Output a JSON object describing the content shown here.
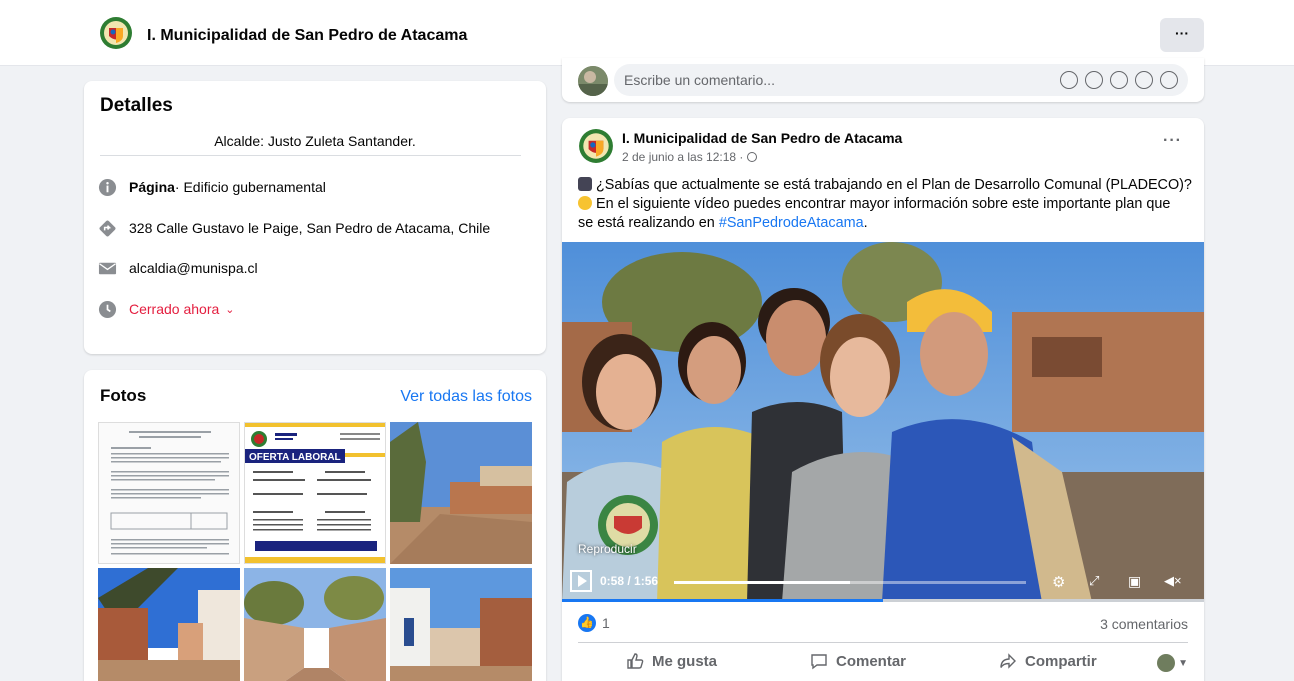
{
  "header": {
    "page_title": "I. Municipalidad de San Pedro de Atacama",
    "more_label": "···"
  },
  "details": {
    "heading": "Detalles",
    "bio": "Alcalde: Justo Zuleta Santander.",
    "category_bold": "Página",
    "category_rest": " · Edificio gubernamental",
    "address": "328 Calle Gustavo le Paige, San Pedro de Atacama, Chile",
    "email": "alcaldia@munispa.cl",
    "hours_status": "Cerrado ahora",
    "hours_caret": "⌄"
  },
  "photos": {
    "heading": "Fotos",
    "see_all": "Ver todas las fotos",
    "poster_title": "OFERTA LABORAL"
  },
  "comment_composer": {
    "placeholder": "Escribe un comentario..."
  },
  "post": {
    "page_name": "I. Municipalidad de San Pedro de Atacama",
    "meta": "2 de junio a las 12:18 · ",
    "more": "···",
    "line1": "¿Sabías que actualmente se está trabajando en el Plan de Desarrollo Comunal (PLADECO)?",
    "line2": "En el siguiente vídeo puedes encontrar mayor información sobre este importante plan que",
    "line3_pre": "se está realizando en ",
    "hashtag": "#SanPedrodeAtacama",
    "line3_post": ".",
    "video": {
      "play_label": "Reproducir",
      "time": "0:58 / 1:56",
      "progress": 0.5
    },
    "likes_count": "1",
    "comments_count": "3 comentarios",
    "actions": {
      "like": "Me gusta",
      "comment": "Comentar",
      "share": "Compartir"
    }
  },
  "colors": {
    "accent": "#1877f2",
    "closed": "#e41e3f"
  }
}
